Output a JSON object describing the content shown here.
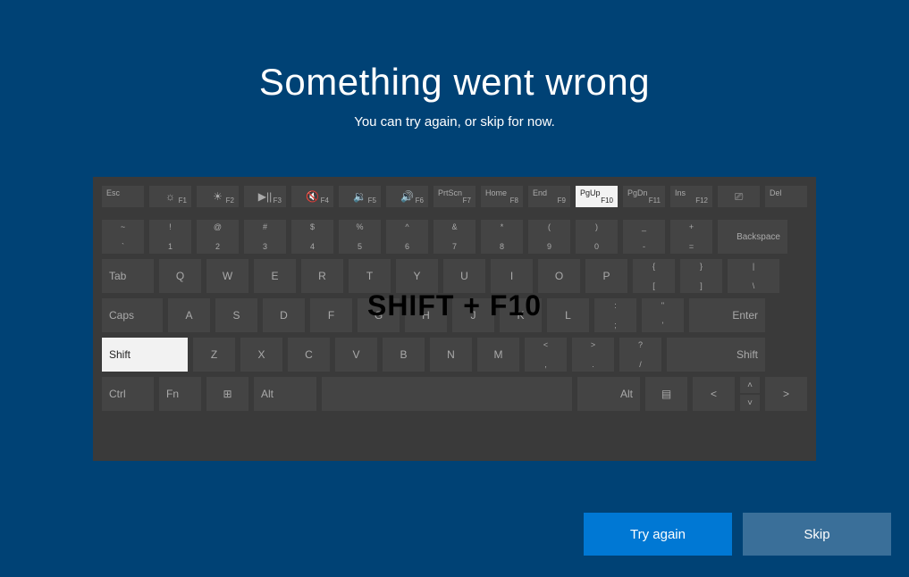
{
  "header": {
    "title": "Something went wrong",
    "subtitle": "You can try again, or skip for now."
  },
  "overlay": "SHIFT + F10",
  "buttons": {
    "try_again": "Try again",
    "skip": "Skip"
  },
  "highlighted_keys": [
    "Shift",
    "F10"
  ],
  "keyboard": {
    "row1": [
      {
        "tl": "Esc"
      },
      {
        "br": "F1",
        "icon": "☼"
      },
      {
        "br": "F2",
        "icon": "☀"
      },
      {
        "br": "F3",
        "icon": "▶||"
      },
      {
        "br": "F4",
        "icon": "🔇"
      },
      {
        "br": "F5",
        "icon": "🔉"
      },
      {
        "br": "F6",
        "icon": "🔊"
      },
      {
        "tl": "PrtScn",
        "br": "F7"
      },
      {
        "tl": "Home",
        "br": "F8"
      },
      {
        "tl": "End",
        "br": "F9"
      },
      {
        "tl": "PgUp",
        "br": "F10",
        "hl": true
      },
      {
        "tl": "PgDn",
        "br": "F11"
      },
      {
        "tl": "Ins",
        "br": "F12"
      },
      {
        "icon": "⎚"
      },
      {
        "tl": "Del"
      }
    ],
    "row2": [
      {
        "top": "~",
        "bot": "`"
      },
      {
        "top": "!",
        "bot": "1"
      },
      {
        "top": "@",
        "bot": "2"
      },
      {
        "top": "#",
        "bot": "3"
      },
      {
        "top": "$",
        "bot": "4"
      },
      {
        "top": "%",
        "bot": "5"
      },
      {
        "top": "^",
        "bot": "6"
      },
      {
        "top": "&",
        "bot": "7"
      },
      {
        "top": "*",
        "bot": "8"
      },
      {
        "top": "(",
        "bot": "9"
      },
      {
        "top": ")",
        "bot": "0"
      },
      {
        "top": "_",
        "bot": "-"
      },
      {
        "top": "+",
        "bot": "="
      },
      {
        "label": "Backspace",
        "wide": "w-bksp",
        "align": "right"
      }
    ],
    "row3": [
      {
        "label": "Tab",
        "wide": "w-tab",
        "align": "left"
      },
      {
        "c": "Q"
      },
      {
        "c": "W"
      },
      {
        "c": "E"
      },
      {
        "c": "R"
      },
      {
        "c": "T"
      },
      {
        "c": "Y"
      },
      {
        "c": "U"
      },
      {
        "c": "I"
      },
      {
        "c": "O"
      },
      {
        "c": "P"
      },
      {
        "top": "{",
        "bot": "["
      },
      {
        "top": "}",
        "bot": "]"
      },
      {
        "top": "|",
        "bot": "\\",
        "wide": "w-tab"
      }
    ],
    "row4": [
      {
        "label": "Caps",
        "wide": "w-caps",
        "align": "left"
      },
      {
        "c": "A"
      },
      {
        "c": "S"
      },
      {
        "c": "D"
      },
      {
        "c": "F"
      },
      {
        "c": "G"
      },
      {
        "c": "H"
      },
      {
        "c": "J"
      },
      {
        "c": "K"
      },
      {
        "c": "L"
      },
      {
        "top": ":",
        "bot": ";"
      },
      {
        "top": "\"",
        "bot": "'"
      },
      {
        "label": "Enter",
        "wide": "w-enter",
        "align": "right"
      }
    ],
    "row5": [
      {
        "label": "Shift",
        "wide": "w-shift-l",
        "align": "left",
        "hl": true
      },
      {
        "c": "Z"
      },
      {
        "c": "X"
      },
      {
        "c": "C"
      },
      {
        "c": "V"
      },
      {
        "c": "B"
      },
      {
        "c": "N"
      },
      {
        "c": "M"
      },
      {
        "top": "<",
        "bot": ","
      },
      {
        "top": ">",
        "bot": "."
      },
      {
        "top": "?",
        "bot": "/"
      },
      {
        "label": "Shift",
        "wide": "w-shift-r",
        "align": "right"
      }
    ],
    "row6": [
      {
        "label": "Ctrl",
        "wide": "w-ctrl",
        "align": "left"
      },
      {
        "label": "Fn",
        "wide": "w-fn",
        "align": "left"
      },
      {
        "icon": "⊞",
        "wide": "w-win"
      },
      {
        "label": "Alt",
        "wide": "w-alt",
        "align": "left"
      },
      {
        "label": "",
        "wide": "w-space"
      },
      {
        "label": "Alt",
        "wide": "w-alt-r",
        "align": "right"
      },
      {
        "icon": "▤",
        "wide": "w-menu"
      },
      {
        "icon": "<",
        "wide": "w-arrows"
      },
      {
        "arrows": true
      },
      {
        "icon": ">",
        "wide": "w-arrows"
      }
    ]
  }
}
